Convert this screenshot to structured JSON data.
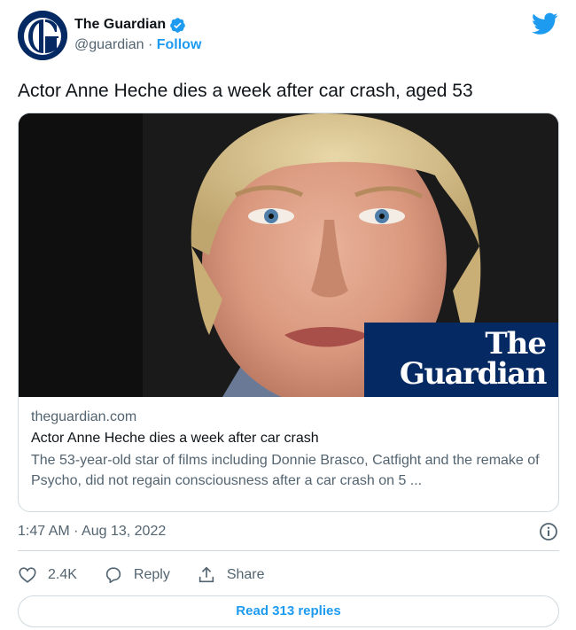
{
  "account": {
    "display_name": "The Guardian",
    "handle": "@guardian",
    "separator": " · ",
    "follow_label": "Follow"
  },
  "tweet": {
    "text": "Actor Anne Heche dies a week after car crash, aged 53"
  },
  "card": {
    "logo_line1": "The",
    "logo_line2": "Guardian",
    "domain": "theguardian.com",
    "title": "Actor Anne Heche dies a week after car crash",
    "description": "The 53-year-old star of films including Donnie Brasco, Catfight and the remake of Psycho, did not regain consciousness after a car crash on 5 ..."
  },
  "meta": {
    "timestamp": "1:47 AM · Aug 13, 2022"
  },
  "actions": {
    "like_count": "2.4K",
    "reply_label": "Reply",
    "share_label": "Share"
  },
  "replies": {
    "label": "Read 313 replies"
  },
  "colors": {
    "twitter_blue": "#1d9bf0",
    "guardian_navy": "#052962",
    "text_secondary": "#536471",
    "border": "#cfd9de"
  }
}
